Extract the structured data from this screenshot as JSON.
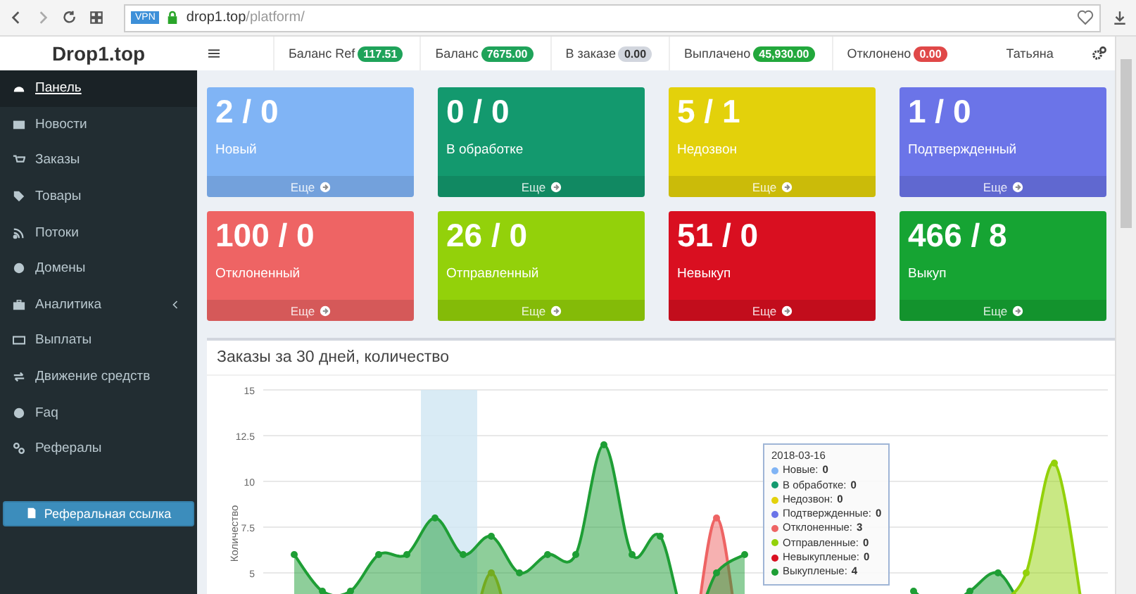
{
  "browser": {
    "vpn_badge": "VPN",
    "url_host": "drop1.top",
    "url_path": "/platform/"
  },
  "logo": "Drop1.top",
  "header": {
    "stats": [
      {
        "label": "Баланс Ref",
        "value": "117.51",
        "color": "#1fa35a"
      },
      {
        "label": "Баланс",
        "value": "7675.00",
        "color": "#1fa35a"
      },
      {
        "label": "В заказе",
        "value": "0.00",
        "color": "#d2d6de"
      },
      {
        "label": "Выплачено",
        "value": "45,930.00",
        "color": "#22a83c"
      },
      {
        "label": "Отклонено",
        "value": "0.00",
        "color": "#e04848"
      }
    ],
    "user": "Татьяна"
  },
  "sidebar": {
    "items": [
      {
        "label": "Панель",
        "selected": true,
        "kind": "link"
      },
      {
        "label": "Новости",
        "selected": false,
        "kind": "link"
      },
      {
        "label": "Заказы",
        "selected": false,
        "kind": "link"
      },
      {
        "label": "Товары",
        "selected": false,
        "kind": "link"
      },
      {
        "label": "Потоки",
        "selected": false,
        "kind": "link"
      },
      {
        "label": "Домены",
        "selected": false,
        "kind": "link"
      },
      {
        "label": "Аналитика",
        "selected": false,
        "kind": "submenu"
      },
      {
        "label": "Выплаты",
        "selected": false,
        "kind": "link"
      },
      {
        "label": "Движение средств",
        "selected": false,
        "kind": "link"
      },
      {
        "label": "Faq",
        "selected": false,
        "kind": "link"
      },
      {
        "label": "Рефералы",
        "selected": false,
        "kind": "link"
      }
    ],
    "button": "Реферальная ссылка"
  },
  "cards": [
    {
      "value": "2 / 0",
      "label": "Новый",
      "link": "Еще",
      "color": "#80b4f5"
    },
    {
      "value": "0 / 0",
      "label": "В обработке",
      "link": "Еще",
      "color": "#13996e"
    },
    {
      "value": "5 / 1",
      "label": "Недозвон",
      "link": "Еще",
      "color": "#e3d10b"
    },
    {
      "value": "1 / 0",
      "label": "Подтвержденный",
      "link": "Еще",
      "color": "#6b74e8"
    },
    {
      "value": "100 / 0",
      "label": "Отклоненный",
      "link": "Еще",
      "color": "#ee6464"
    },
    {
      "value": "26 / 0",
      "label": "Отправленный",
      "link": "Еще",
      "color": "#93d10a"
    },
    {
      "value": "51 / 0",
      "label": "Невыкуп",
      "link": "Еще",
      "color": "#d90f20"
    },
    {
      "value": "466 / 8",
      "label": "Выкуп",
      "link": "Еще",
      "color": "#16a433"
    }
  ],
  "chart": {
    "title": "Заказы за 30 дней, количество",
    "chart_data": {
      "type": "area",
      "ylabel": "Количество",
      "ylim": [
        0,
        15
      ],
      "yticks": [
        5,
        7.5,
        10,
        12.5,
        15
      ],
      "grid": true,
      "series": [
        {
          "color": "#c9b80a",
          "values": [
            0,
            0,
            0,
            0,
            0,
            0,
            0,
            5,
            0,
            0,
            0,
            0,
            0,
            0,
            0,
            0,
            0,
            0,
            0,
            0,
            0,
            0,
            0,
            0,
            0,
            0,
            0,
            0,
            0
          ]
        },
        {
          "color": "#ee6464",
          "values": [
            0,
            0,
            0,
            0,
            0,
            0,
            0,
            0,
            0,
            0,
            0,
            0,
            0,
            0,
            0,
            8,
            0,
            0,
            0,
            0,
            0,
            0,
            0,
            0,
            0,
            0,
            0,
            0,
            0
          ]
        },
        {
          "color": "#1e9e35",
          "values": [
            6,
            4,
            4,
            6,
            6,
            8,
            6,
            7,
            5,
            6,
            6,
            12,
            6,
            7,
            2,
            5,
            6,
            null,
            null,
            null,
            null,
            null,
            4,
            3,
            4,
            5,
            3,
            3,
            3
          ]
        },
        {
          "color": "#93d10a",
          "values": [
            0,
            0,
            0,
            0,
            0,
            0,
            0,
            0,
            0,
            0,
            0,
            0,
            0,
            0,
            0,
            0,
            0,
            0,
            0,
            0,
            0,
            0,
            0,
            0,
            0,
            3,
            5,
            11,
            3
          ]
        }
      ]
    },
    "tooltip": {
      "date": "2018-03-16",
      "rows": [
        {
          "label": "Новые:",
          "value": "0",
          "color": "#80b4f5"
        },
        {
          "label": "В обработке:",
          "value": "0",
          "color": "#13996e"
        },
        {
          "label": "Недозвон:",
          "value": "0",
          "color": "#e3d10b"
        },
        {
          "label": "Подтвержденные:",
          "value": "0",
          "color": "#6b74e8"
        },
        {
          "label": "Отклоненные:",
          "value": "3",
          "color": "#ee6464"
        },
        {
          "label": "Отправленные:",
          "value": "0",
          "color": "#93d10a"
        },
        {
          "label": "Невыкупленые:",
          "value": "0",
          "color": "#d90f20"
        },
        {
          "label": "Выкупленые:",
          "value": "4",
          "color": "#1e9e35"
        }
      ]
    }
  }
}
